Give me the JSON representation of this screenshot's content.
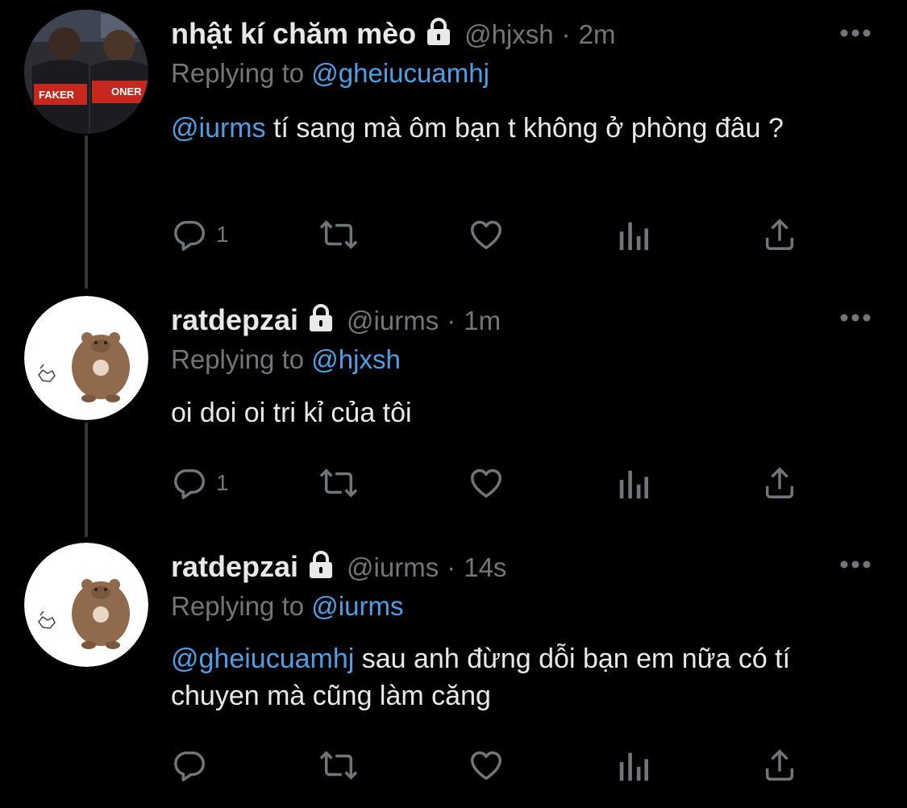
{
  "tweets": [
    {
      "display_name": "nhật kí chăm mèo",
      "handle": "@hjxsh",
      "separator": "·",
      "time": "2m",
      "replying_prefix": "Replying to",
      "replying_handle": "@gheiucuamhj",
      "text_mention": "@iurms",
      "text": " tí sang mà ôm bạn t không ở phòng đâu ?",
      "reply_count": "1",
      "avatar_labels": [
        "FAKER",
        "ONER"
      ]
    },
    {
      "display_name": "ratdepzai",
      "handle": "@iurms",
      "separator": "·",
      "time": "1m",
      "replying_prefix": "Replying to",
      "replying_handle": "@hjxsh",
      "text_mention": "",
      "text": "oi doi oi tri kỉ của tôi",
      "reply_count": "1"
    },
    {
      "display_name": "ratdepzai",
      "handle": "@iurms",
      "separator": "·",
      "time": "14s",
      "replying_prefix": "Replying to",
      "replying_handle": "@iurms",
      "text_mention": "@gheiucuamhj",
      "text": " sau anh đừng dỗi bạn em nữa có tí chuyen mà cũng làm căng",
      "reply_count": ""
    }
  ],
  "colors": {
    "background": "#000000",
    "primary_text": "#e7e9ea",
    "secondary_text": "#71767b",
    "link": "#4e9fe6",
    "thread_line": "#333639"
  }
}
